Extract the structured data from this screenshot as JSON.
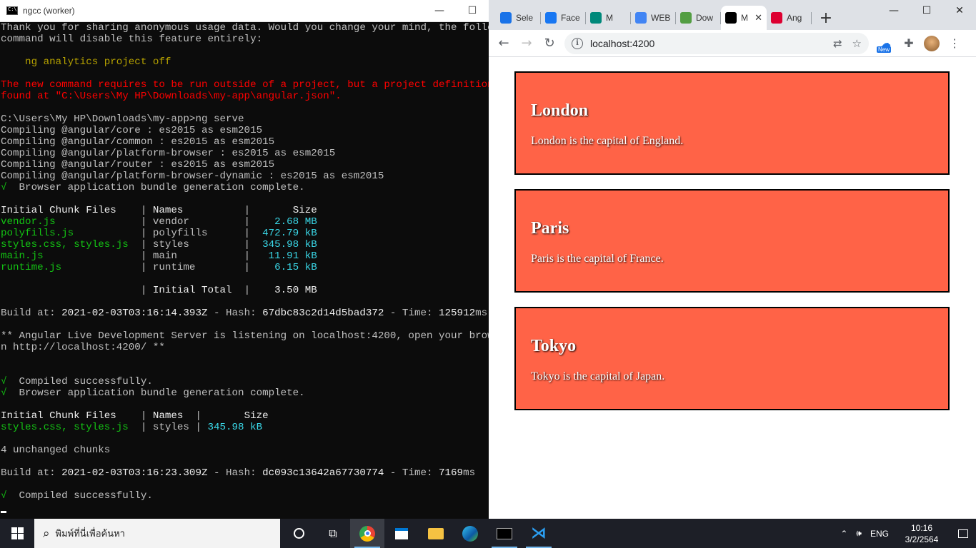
{
  "console": {
    "title": "ngcc (worker)",
    "lines": [
      {
        "segs": [
          {
            "c": "gry",
            "t": "Thank you for sharing anonymous usage data. Would you change your mind, the following"
          }
        ]
      },
      {
        "segs": [
          {
            "c": "gry",
            "t": "command will disable this feature entirely:"
          }
        ]
      },
      {
        "segs": [
          {
            "c": "gry",
            "t": ""
          }
        ]
      },
      {
        "segs": [
          {
            "c": "yel",
            "t": "    ng analytics project off"
          }
        ]
      },
      {
        "segs": [
          {
            "c": "gry",
            "t": ""
          }
        ]
      },
      {
        "segs": [
          {
            "c": "red",
            "t": "The new command requires to be run outside of a project, but a project definition was"
          }
        ]
      },
      {
        "segs": [
          {
            "c": "red",
            "t": "found at \"C:\\Users\\My HP\\Downloads\\my-app\\angular.json\"."
          }
        ]
      },
      {
        "segs": [
          {
            "c": "gry",
            "t": ""
          }
        ]
      },
      {
        "segs": [
          {
            "c": "gry",
            "t": "C:\\Users\\My HP\\Downloads\\my-app>ng serve"
          }
        ]
      },
      {
        "segs": [
          {
            "c": "gry",
            "t": "Compiling @angular/core : es2015 as esm2015"
          }
        ]
      },
      {
        "segs": [
          {
            "c": "gry",
            "t": "Compiling @angular/common : es2015 as esm2015"
          }
        ]
      },
      {
        "segs": [
          {
            "c": "gry",
            "t": "Compiling @angular/platform-browser : es2015 as esm2015"
          }
        ]
      },
      {
        "segs": [
          {
            "c": "gry",
            "t": "Compiling @angular/router : es2015 as esm2015"
          }
        ]
      },
      {
        "segs": [
          {
            "c": "gry",
            "t": "Compiling @angular/platform-browser-dynamic : es2015 as esm2015"
          }
        ]
      },
      {
        "segs": [
          {
            "c": "grn",
            "t": "√"
          },
          {
            "c": "gry",
            "t": "  Browser application bundle generation complete."
          }
        ]
      },
      {
        "segs": [
          {
            "c": "gry",
            "t": ""
          }
        ]
      },
      {
        "segs": [
          {
            "c": "wht",
            "t": "Initial Chunk Files"
          },
          {
            "c": "gry",
            "t": "    | "
          },
          {
            "c": "wht",
            "t": "Names"
          },
          {
            "c": "gry",
            "t": "          | "
          },
          {
            "c": "wht",
            "t": "      Size"
          }
        ]
      },
      {
        "segs": [
          {
            "c": "grn",
            "t": "vendor.js"
          },
          {
            "c": "gry",
            "t": "              | vendor         | "
          },
          {
            "c": "cyn",
            "t": "   2.68 MB"
          }
        ]
      },
      {
        "segs": [
          {
            "c": "grn",
            "t": "polyfills.js"
          },
          {
            "c": "gry",
            "t": "           | polyfills      | "
          },
          {
            "c": "cyn",
            "t": " 472.79 kB"
          }
        ]
      },
      {
        "segs": [
          {
            "c": "grn",
            "t": "styles.css, styles.js"
          },
          {
            "c": "gry",
            "t": "  | styles         | "
          },
          {
            "c": "cyn",
            "t": " 345.98 kB"
          }
        ]
      },
      {
        "segs": [
          {
            "c": "grn",
            "t": "main.js"
          },
          {
            "c": "gry",
            "t": "                | main           | "
          },
          {
            "c": "cyn",
            "t": "  11.91 kB"
          }
        ]
      },
      {
        "segs": [
          {
            "c": "grn",
            "t": "runtime.js"
          },
          {
            "c": "gry",
            "t": "             | runtime        | "
          },
          {
            "c": "cyn",
            "t": "   6.15 kB"
          }
        ]
      },
      {
        "segs": [
          {
            "c": "gry",
            "t": ""
          }
        ]
      },
      {
        "segs": [
          {
            "c": "gry",
            "t": "                       | "
          },
          {
            "c": "wht",
            "t": "Initial Total"
          },
          {
            "c": "gry",
            "t": "  | "
          },
          {
            "c": "wht",
            "t": "   3.50 MB"
          }
        ]
      },
      {
        "segs": [
          {
            "c": "gry",
            "t": ""
          }
        ]
      },
      {
        "segs": [
          {
            "c": "gry",
            "t": "Build at: "
          },
          {
            "c": "wht",
            "t": "2021-02-03T03:16:14.393Z"
          },
          {
            "c": "gry",
            "t": " - Hash: "
          },
          {
            "c": "wht",
            "t": "67dbc83c2d14d5bad372"
          },
          {
            "c": "gry",
            "t": " - Time: "
          },
          {
            "c": "wht",
            "t": "125912"
          },
          {
            "c": "gry",
            "t": "ms"
          }
        ]
      },
      {
        "segs": [
          {
            "c": "gry",
            "t": ""
          }
        ]
      },
      {
        "segs": [
          {
            "c": "gry",
            "t": "** Angular Live Development Server is listening on localhost:4200, open your browser o"
          }
        ]
      },
      {
        "segs": [
          {
            "c": "gry",
            "t": "n http://localhost:4200/ **"
          }
        ]
      },
      {
        "segs": [
          {
            "c": "gry",
            "t": ""
          }
        ]
      },
      {
        "segs": [
          {
            "c": "gry",
            "t": ""
          }
        ]
      },
      {
        "segs": [
          {
            "c": "grn",
            "t": "√"
          },
          {
            "c": "gry",
            "t": "  Compiled successfully."
          }
        ]
      },
      {
        "segs": [
          {
            "c": "grn",
            "t": "√"
          },
          {
            "c": "gry",
            "t": "  Browser application bundle generation complete."
          }
        ]
      },
      {
        "segs": [
          {
            "c": "gry",
            "t": ""
          }
        ]
      },
      {
        "segs": [
          {
            "c": "wht",
            "t": "Initial Chunk Files"
          },
          {
            "c": "gry",
            "t": "    | "
          },
          {
            "c": "wht",
            "t": "Names"
          },
          {
            "c": "gry",
            "t": "  | "
          },
          {
            "c": "wht",
            "t": "      Size"
          }
        ]
      },
      {
        "segs": [
          {
            "c": "grn",
            "t": "styles.css, styles.js"
          },
          {
            "c": "gry",
            "t": "  | styles | "
          },
          {
            "c": "cyn",
            "t": "345.98 kB"
          }
        ]
      },
      {
        "segs": [
          {
            "c": "gry",
            "t": ""
          }
        ]
      },
      {
        "segs": [
          {
            "c": "gry",
            "t": "4 unchanged chunks"
          }
        ]
      },
      {
        "segs": [
          {
            "c": "gry",
            "t": ""
          }
        ]
      },
      {
        "segs": [
          {
            "c": "gry",
            "t": "Build at: "
          },
          {
            "c": "wht",
            "t": "2021-02-03T03:16:23.309Z"
          },
          {
            "c": "gry",
            "t": " - Hash: "
          },
          {
            "c": "wht",
            "t": "dc093c13642a67730774"
          },
          {
            "c": "gry",
            "t": " - Time: "
          },
          {
            "c": "wht",
            "t": "7169"
          },
          {
            "c": "gry",
            "t": "ms"
          }
        ]
      },
      {
        "segs": [
          {
            "c": "gry",
            "t": ""
          }
        ]
      },
      {
        "segs": [
          {
            "c": "grn",
            "t": "√"
          },
          {
            "c": "gry",
            "t": "  Compiled successfully."
          }
        ]
      }
    ]
  },
  "browser": {
    "tabs": [
      {
        "label": "Sele",
        "icon": "person-icon",
        "color": "#1a73e8"
      },
      {
        "label": "Face",
        "icon": "facebook-icon",
        "color": "#1877f2"
      },
      {
        "label": "M",
        "icon": "meet-icon",
        "color": "#00897b"
      },
      {
        "label": "WEB",
        "icon": "docs-icon",
        "color": "#4285f4"
      },
      {
        "label": "Dow",
        "icon": "nodejs-icon",
        "color": "#539e43"
      },
      {
        "label": "M",
        "icon": "angular-icon",
        "color": "#000000",
        "active": true
      },
      {
        "label": "Ang",
        "icon": "angular-icon",
        "color": "#dd0031"
      }
    ],
    "url": "localhost:4200"
  },
  "cities": [
    {
      "name": "London",
      "description": "London is the capital of England."
    },
    {
      "name": "Paris",
      "description": "Paris is the capital of France."
    },
    {
      "name": "Tokyo",
      "description": "Tokyo is the capital of Japan."
    }
  ],
  "taskbar": {
    "search_placeholder": "พิมพ์ที่นี่เพื่อค้นหา",
    "language": "ENG",
    "time": "10:16",
    "date": "3/2/2564"
  },
  "colors": {
    "card_background": "#ff6347",
    "console_background": "#0c0c0c"
  }
}
